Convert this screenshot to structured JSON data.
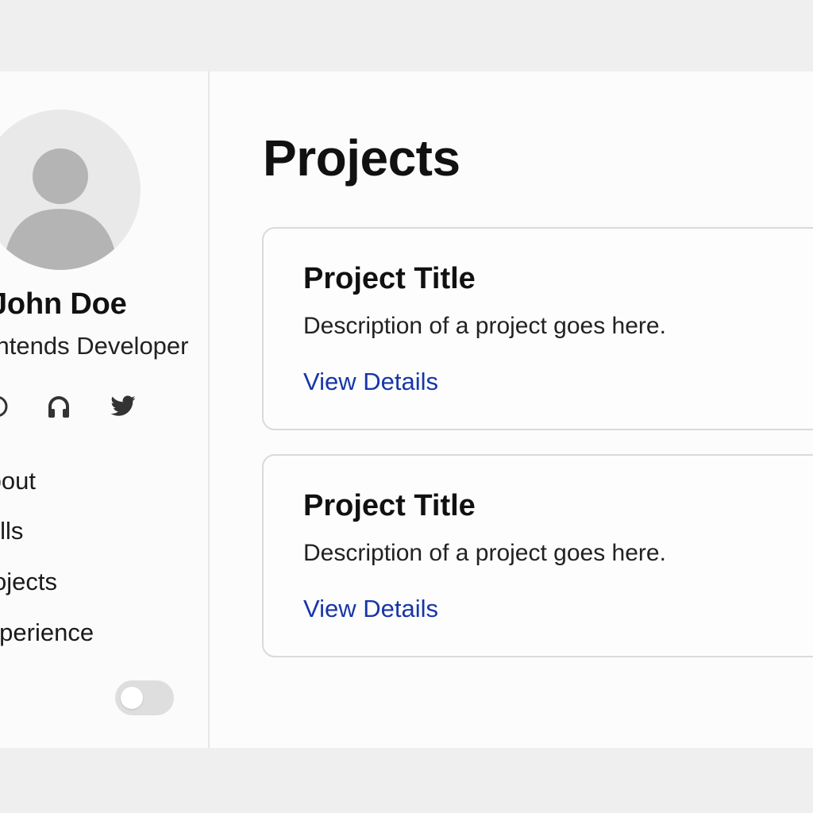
{
  "profile": {
    "name": "John Doe",
    "role": "Frontends Developer",
    "avatar_icon": "user-avatar-icon"
  },
  "social": [
    {
      "icon": "linkedin-icon"
    },
    {
      "icon": "github-icon"
    },
    {
      "icon": "twitter-icon"
    }
  ],
  "nav": {
    "items": [
      {
        "label": "About"
      },
      {
        "label": "Skills"
      },
      {
        "label": "Projects"
      },
      {
        "label": "Experience"
      }
    ]
  },
  "theme_toggle": {
    "state": "off"
  },
  "main": {
    "title": "Projects",
    "cards": [
      {
        "title": "Project Title",
        "description": "Description of a project goes here.",
        "link_label": "View Details"
      },
      {
        "title": "Project Title",
        "description": "Description of a project goes here.",
        "link_label": "View Details"
      }
    ]
  },
  "colors": {
    "link": "#1736a8",
    "page_background": "#efefef",
    "panel_background": "#fcfcfc",
    "border": "#dadada"
  }
}
